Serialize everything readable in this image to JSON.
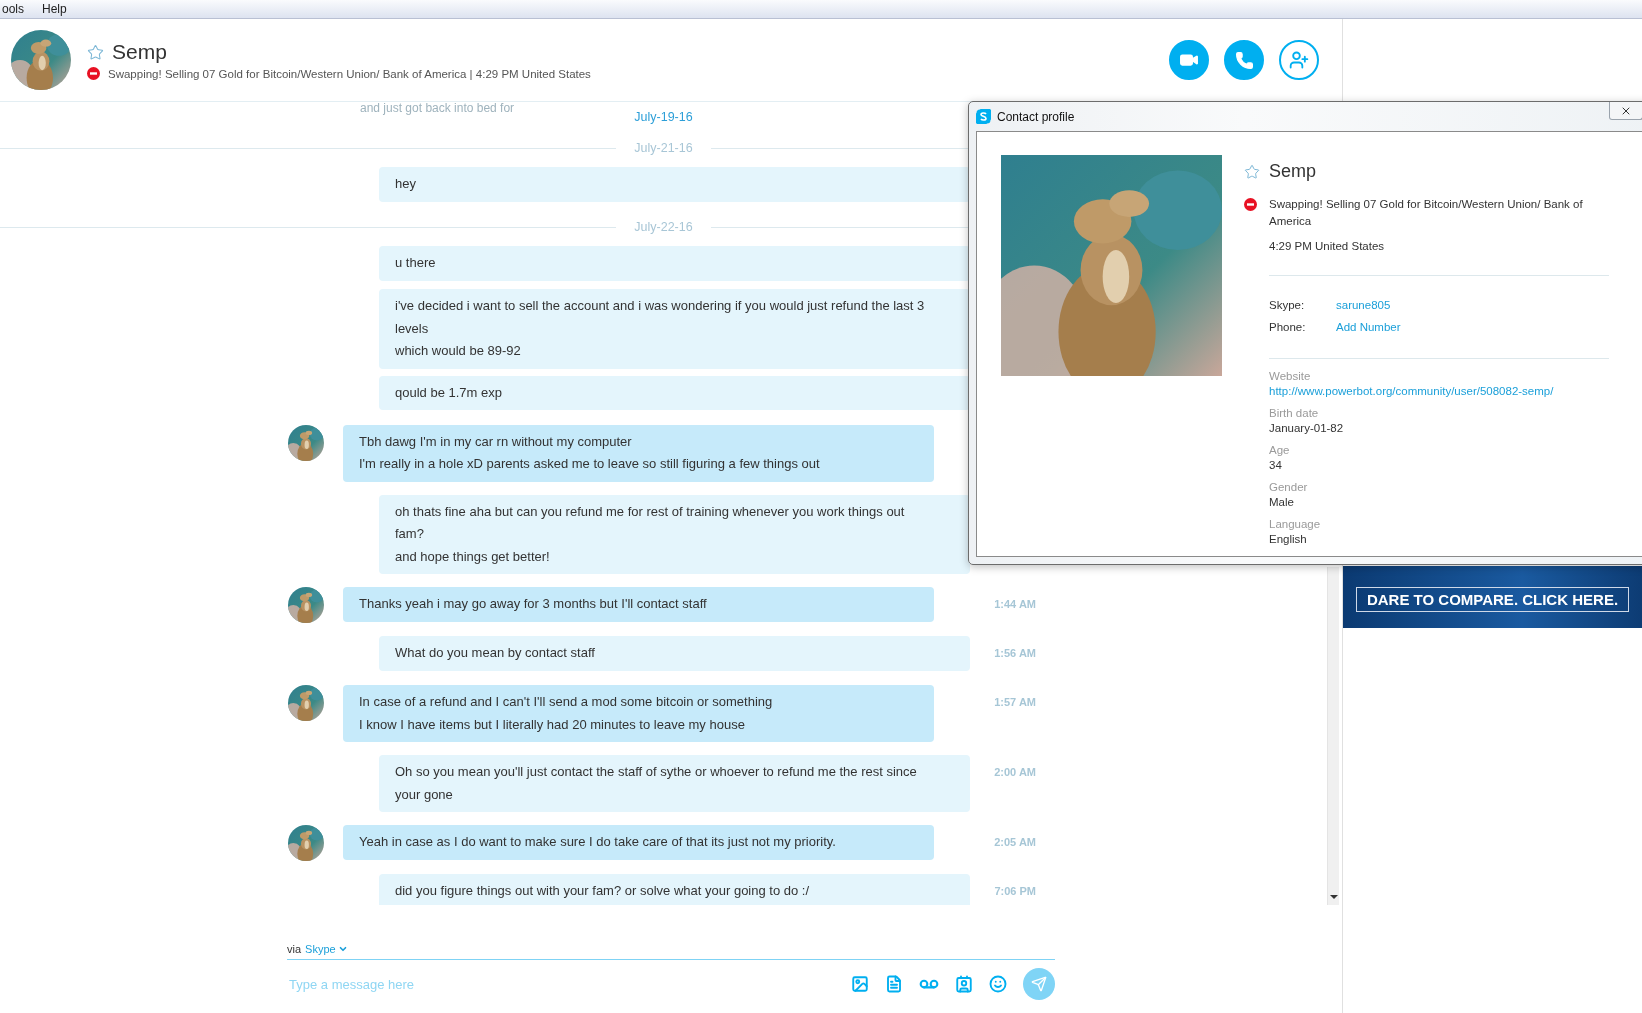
{
  "menu": [
    {
      "label": "ools"
    },
    {
      "label": "Help"
    }
  ],
  "contact": {
    "name": "Semp",
    "mood": "Swapping! Selling 07 Gold for Bitcoin/Western Union/ Bank of America",
    "separator": "|",
    "local_time": "4:29 PM United States"
  },
  "chat": {
    "sticky_date": "July-19-16",
    "faded_message": "and just got back into bed for",
    "items": [
      {
        "kind": "date",
        "text": "July-21-16"
      },
      {
        "kind": "sent",
        "lines": [
          "hey"
        ]
      },
      {
        "kind": "date",
        "text": "July-22-16"
      },
      {
        "kind": "sent",
        "lines": [
          "u there"
        ]
      },
      {
        "kind": "sent",
        "lines": [
          "i've decided i want to sell the account and i was wondering if you would just refund the last 3 levels",
          "which would be 89-92"
        ]
      },
      {
        "kind": "sent",
        "lines": [
          "qould be 1.7m exp"
        ]
      },
      {
        "kind": "received",
        "lines": [
          "Tbh dawg I'm in my car rn without my computer",
          "I'm really in a hole xD parents asked me to leave so still figuring a few things out"
        ]
      },
      {
        "kind": "sent",
        "lines": [
          "oh thats fine aha but can you refund me  for rest of training whenever you work things out fam?",
          "and hope things get better!"
        ]
      },
      {
        "kind": "received",
        "lines": [
          "Thanks yeah i may go away for 3 months but I'll contact staff"
        ],
        "time": "1:44 AM"
      },
      {
        "kind": "sent",
        "lines": [
          "What do you mean by contact staff"
        ],
        "time": "1:56 AM"
      },
      {
        "kind": "received",
        "lines": [
          "In case of a refund and I can't I'll send a mod some bitcoin or something",
          "I know I have items but I literally had 20 minutes to leave my house"
        ],
        "time": "1:57 AM"
      },
      {
        "kind": "sent",
        "lines": [
          "Oh so you mean you'll just contact the staff of sythe or whoever to refund me the rest since your gone"
        ],
        "time": "2:00 AM"
      },
      {
        "kind": "received",
        "lines": [
          "Yeah in case as I do want to make sure I do take care of that its just not my priority."
        ],
        "time": "2:05 AM"
      },
      {
        "kind": "sent",
        "lines": [
          "did you figure things out with your fam? or solve what your going to do :/"
        ],
        "time": "7:06 PM"
      }
    ]
  },
  "composer": {
    "via_label": "via",
    "via_service": "Skype",
    "placeholder": "Type a message here"
  },
  "profile": {
    "title": "Contact profile",
    "name": "Semp",
    "mood": "Swapping! Selling 07 Gold for Bitcoin/Western Union/ Bank of America",
    "local_time": "4:29 PM United States",
    "fields": [
      {
        "label": "Skype:",
        "value": "sarune805"
      },
      {
        "label": "Phone:",
        "value": "Add Number"
      }
    ],
    "details": [
      {
        "label": "Website",
        "value": "http://www.powerbot.org/community/user/508082-semp/",
        "link": true
      },
      {
        "label": "Birth date",
        "value": "January-01-82",
        "link": false
      },
      {
        "label": "Age",
        "value": "34",
        "link": false
      },
      {
        "label": "Gender",
        "value": "Male",
        "link": false
      },
      {
        "label": "Language",
        "value": "English",
        "link": false
      }
    ]
  },
  "ad": {
    "text": "DARE TO COMPARE. CLICK HERE."
  }
}
